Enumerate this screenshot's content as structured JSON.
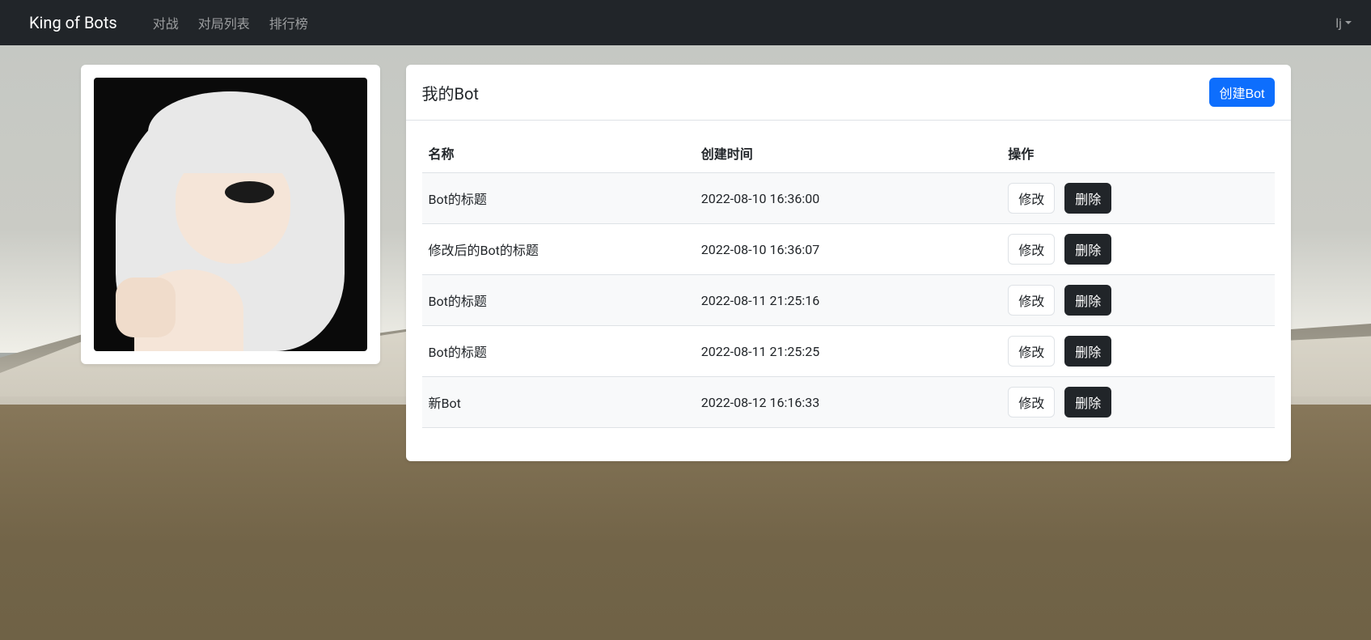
{
  "navbar": {
    "brand": "King of Bots",
    "links": [
      "对战",
      "对局列表",
      "排行榜"
    ],
    "user": "lj"
  },
  "main": {
    "title": "我的Bot",
    "create_button": "创建Bot",
    "table": {
      "headers": {
        "name": "名称",
        "time": "创建时间",
        "ops": "操作"
      },
      "edit_label": "修改",
      "delete_label": "删除",
      "rows": [
        {
          "name": "Bot的标题",
          "time": "2022-08-10 16:36:00"
        },
        {
          "name": "修改后的Bot的标题",
          "time": "2022-08-10 16:36:07"
        },
        {
          "name": "Bot的标题",
          "time": "2022-08-11 21:25:16"
        },
        {
          "name": "Bot的标题",
          "time": "2022-08-11 21:25:25"
        },
        {
          "name": "新Bot",
          "time": "2022-08-12 16:16:33"
        }
      ]
    }
  }
}
